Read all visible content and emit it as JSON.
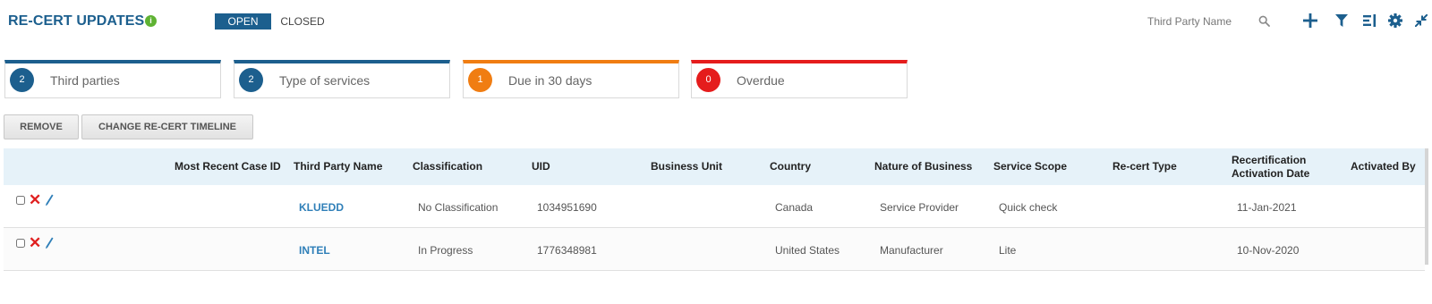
{
  "header": {
    "title": "RE-CERT UPDATES",
    "info_icon": "info-icon",
    "tabs": [
      {
        "label": "OPEN",
        "active": true
      },
      {
        "label": "CLOSED",
        "active": false
      }
    ],
    "search": {
      "placeholder": "Third Party Name",
      "value": ""
    },
    "tools": [
      "search-icon",
      "add-icon",
      "filter-icon",
      "columns-icon",
      "gear-icon",
      "collapse-icon"
    ]
  },
  "stats": [
    {
      "count": "2",
      "label": "Third parties",
      "color": "#1c5f8e"
    },
    {
      "count": "2",
      "label": "Type of services",
      "color": "#1c5f8e"
    },
    {
      "count": "1",
      "label": "Due in 30 days",
      "color": "#f07d12"
    },
    {
      "count": "0",
      "label": "Overdue",
      "color": "#e51c1c"
    }
  ],
  "actions": {
    "remove_label": "REMOVE",
    "change_timeline_label": "CHANGE RE-CERT TIMELINE"
  },
  "table": {
    "columns": [
      "Most Recent Case ID",
      "Third Party Name",
      "Classification",
      "UID",
      "Business Unit",
      "Country",
      "Nature of Business",
      "Service Scope",
      "Re-cert Type",
      "Recertification Activation Date",
      "Activated By"
    ],
    "rows": [
      {
        "case_id": "",
        "third_party_name": "KLUEDD",
        "classification": "No Classification",
        "uid": "1034951690",
        "business_unit": "",
        "country": "Canada",
        "nature_of_business": "Service Provider",
        "service_scope": "Quick check",
        "recert_type": "",
        "activation_date": "11-Jan-2021",
        "activated_by": ""
      },
      {
        "case_id": "",
        "third_party_name": "INTEL",
        "classification": "In Progress",
        "uid": "1776348981",
        "business_unit": "",
        "country": "United States",
        "nature_of_business": "Manufacturer",
        "service_scope": "Lite",
        "recert_type": "",
        "activation_date": "10-Nov-2020",
        "activated_by": ""
      }
    ]
  },
  "colors": {
    "brand": "#1c5f8e",
    "link": "#2f7fb8",
    "header_bg": "#e6f2f9",
    "delete": "#e02020"
  }
}
